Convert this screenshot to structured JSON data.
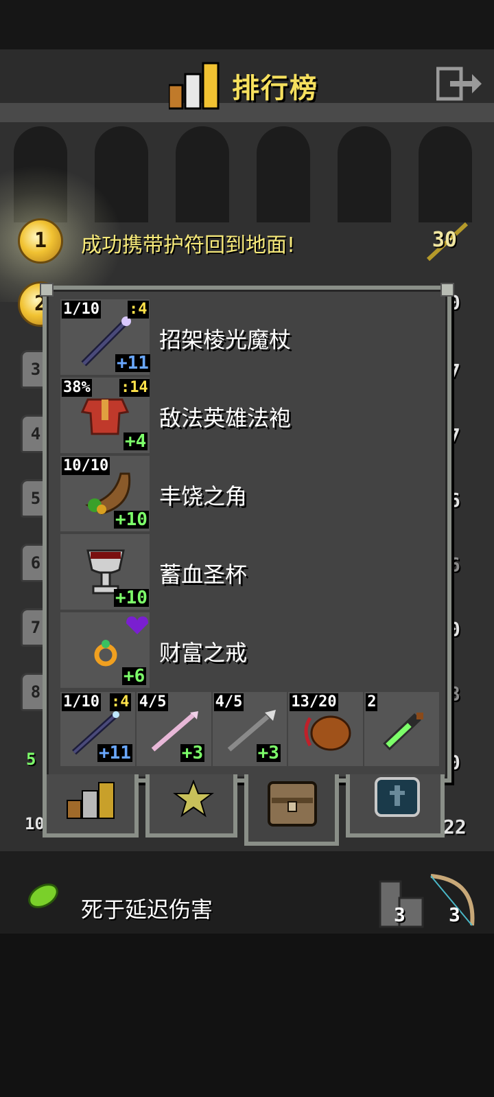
{
  "header": {
    "title": "排行榜"
  },
  "ranks": [
    {
      "rank": "1",
      "text": "成功携带护符回到地面!",
      "score": "30"
    }
  ],
  "right_peek": [
    "0",
    "7",
    "7",
    "6",
    "6",
    "0",
    "8",
    "0",
    "22"
  ],
  "left_badges": [
    "2",
    "3",
    "4",
    "5",
    "6",
    "7",
    "8"
  ],
  "left_peek": [
    "5",
    "10"
  ],
  "items": [
    {
      "name": "招架棱光魔杖",
      "charges": "1/10",
      "level": ":4",
      "bonus": "+11",
      "bonus_color": "blue"
    },
    {
      "name": "敌法英雄法袍",
      "charges": "38%",
      "level": ":14",
      "bonus": "+4",
      "bonus_color": "green"
    },
    {
      "name": "丰饶之角",
      "charges": "10/10",
      "level": "",
      "bonus": "+10",
      "bonus_color": "green"
    },
    {
      "name": "蓄血圣杯",
      "charges": "",
      "level": "",
      "bonus": "+10",
      "bonus_color": "green"
    },
    {
      "name": "财富之戒",
      "charges": "",
      "level": "",
      "bonus": "+6",
      "bonus_color": "green"
    }
  ],
  "quickslots": [
    {
      "top_left": "1/10",
      "top_right": ":4",
      "bonus": "+11",
      "bonus_color": "blue",
      "icon": "wand-icon"
    },
    {
      "top_left": "4/5",
      "top_right": "",
      "bonus": "+3",
      "bonus_color": "green",
      "icon": "pink-spear-icon"
    },
    {
      "top_left": "4/5",
      "top_right": "",
      "bonus": "+3",
      "bonus_color": "green",
      "icon": "spear-icon"
    },
    {
      "top_left": "13/20",
      "top_right": "",
      "bonus": "",
      "bonus_color": "",
      "icon": "meat-icon"
    },
    {
      "top_left": "2",
      "top_right": "",
      "bonus": "",
      "bonus_color": "",
      "icon": "potion-icon"
    }
  ],
  "tabs": [
    {
      "icon": "leaderboard-icon"
    },
    {
      "icon": "star-icon"
    },
    {
      "icon": "backpack-icon"
    },
    {
      "icon": "shield-icon"
    }
  ],
  "bottom": {
    "text": "死于延迟伤害",
    "left_num": "3",
    "right_num": "3"
  },
  "colors": {
    "title": "#f6e05e",
    "panel": "#434343",
    "slot": "#555555",
    "green": "#7dff6a",
    "blue": "#6aa8ff",
    "yellow": "#ffe24a"
  }
}
